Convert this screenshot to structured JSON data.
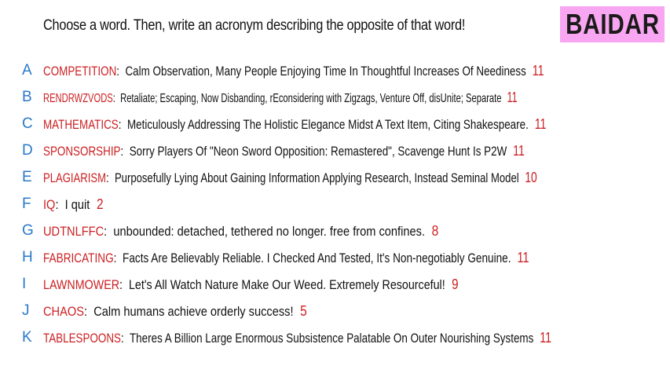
{
  "header": {
    "prompt": "Choose a word. Then, write an acronym describing the opposite of that word!",
    "badge": "BAIDAR",
    "badge_color": "#f9a6f2"
  },
  "colors": {
    "letter": "#2a79c9",
    "word": "#cc1f22",
    "score": "#cc1f22",
    "text": "#111111"
  },
  "rows": [
    {
      "letter": "A",
      "word": "COMPETITION",
      "sep": ":",
      "text": "Calm Observation, Many People Enjoying Time In Thoughtful Increases Of Neediness",
      "score": "11"
    },
    {
      "letter": "B",
      "word": "RENDRWZVODS",
      "sep": ":",
      "text": "Retaliate; Escaping, Now Disbanding, rEconsidering with Zigzags, Venture Off, disUnite; Separate",
      "score": "11"
    },
    {
      "letter": "C",
      "word": "MATHEMATICS",
      "sep": ":",
      "text": "Meticulously Addressing The Holistic Elegance Midst A Text Item, Citing Shakespeare.",
      "score": "11"
    },
    {
      "letter": "D",
      "word": "SPONSORSHIP",
      "sep": ":",
      "text": "Sorry Players Of \"Neon Sword Opposition: Remastered\", Scavenge Hunt Is P2W",
      "score": "11"
    },
    {
      "letter": "E",
      "word": "PLAGIARISM",
      "sep": ":",
      "text": "Purposefully Lying About Gaining Information Applying Research, Instead Seminal Model",
      "score": "10"
    },
    {
      "letter": "F",
      "word": "IQ",
      "sep": ":",
      "text": "I quit",
      "score": "2"
    },
    {
      "letter": "G",
      "word": "UDTNLFFC",
      "sep": ":",
      "text": "unbounded: detached, tethered no longer. free from confines.",
      "score": "8"
    },
    {
      "letter": "H",
      "word": "FABRICATING",
      "sep": ":",
      "text": "Facts Are Believably Reliable. I Checked And Tested, It's Non-negotiably Genuine.",
      "score": "11"
    },
    {
      "letter": "I",
      "word": "LAWNMOWER",
      "sep": ":",
      "text": "Let's All Watch Nature Make Our Weed. Extremely Resourceful!",
      "score": "9"
    },
    {
      "letter": "J",
      "word": "CHAOS",
      "sep": ":",
      "text": "Calm humans achieve orderly success!",
      "score": "5"
    },
    {
      "letter": "K",
      "word": "TABLESPOONS",
      "sep": ":",
      "text": "Theres A Billion Large Enormous Subsistence Palatable On Outer Nourishing Systems",
      "score": "11"
    }
  ]
}
